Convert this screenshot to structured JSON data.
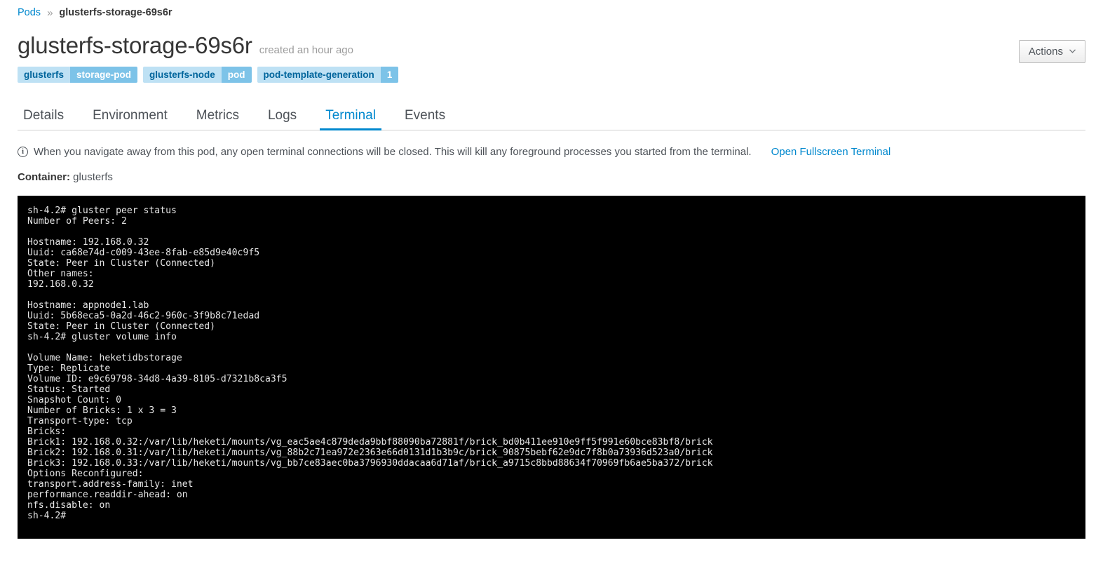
{
  "breadcrumb": {
    "root_label": "Pods",
    "separator": "»",
    "current_label": "glusterfs-storage-69s6r"
  },
  "header": {
    "title": "glusterfs-storage-69s6r",
    "created_at": "created an hour ago",
    "actions_label": "Actions",
    "actions_caret": "∨"
  },
  "labels": [
    {
      "key": "glusterfs",
      "value": "storage-pod"
    },
    {
      "key": "glusterfs-node",
      "value": "pod"
    },
    {
      "key": "pod-template-generation",
      "value": "1"
    }
  ],
  "tabs": [
    {
      "label": "Details",
      "active": false
    },
    {
      "label": "Environment",
      "active": false
    },
    {
      "label": "Metrics",
      "active": false
    },
    {
      "label": "Logs",
      "active": false
    },
    {
      "label": "Terminal",
      "active": true
    },
    {
      "label": "Events",
      "active": false
    }
  ],
  "notice": {
    "icon": "info-circle-icon",
    "glyph": "i",
    "text": "When you navigate away from this pod, any open terminal connections will be closed. This will kill any foreground processes you started from the terminal.",
    "link_label": "Open Fullscreen Terminal"
  },
  "container": {
    "label": "Container:",
    "name": "glusterfs"
  },
  "terminal": {
    "background": "#000000",
    "foreground": "#e6e6e6",
    "content": "sh-4.2# gluster peer status\nNumber of Peers: 2\n\nHostname: 192.168.0.32\nUuid: ca68e74d-c009-43ee-8fab-e85d9e40c9f5\nState: Peer in Cluster (Connected)\nOther names:\n192.168.0.32\n\nHostname: appnode1.lab\nUuid: 5b68eca5-0a2d-46c2-960c-3f9b8c71edad\nState: Peer in Cluster (Connected)\nsh-4.2# gluster volume info\n\nVolume Name: heketidbstorage\nType: Replicate\nVolume ID: e9c69798-34d8-4a39-8105-d7321b8ca3f5\nStatus: Started\nSnapshot Count: 0\nNumber of Bricks: 1 x 3 = 3\nTransport-type: tcp\nBricks:\nBrick1: 192.168.0.32:/var/lib/heketi/mounts/vg_eac5ae4c879deda9bbf88090ba72881f/brick_bd0b411ee910e9ff5f991e60bce83bf8/brick\nBrick2: 192.168.0.31:/var/lib/heketi/mounts/vg_88b2c71ea972e2363e66d0131d1b3b9c/brick_90875bebf62e9dc7f8b0a73936d523a0/brick\nBrick3: 192.168.0.33:/var/lib/heketi/mounts/vg_bb7ce83aec0ba3796930ddacaa6d71af/brick_a9715c8bbd88634f70969fb6ae5ba372/brick\nOptions Reconfigured:\ntransport.address-family: inet\nperformance.readdir-ahead: on\nnfs.disable: on\nsh-4.2#"
  },
  "colors": {
    "link": "#0088ce",
    "active_tab": "#0088ce",
    "label_key_bg": "#bee1f4",
    "label_value_bg": "#7dc3e8",
    "terminal_bg": "#000000"
  }
}
